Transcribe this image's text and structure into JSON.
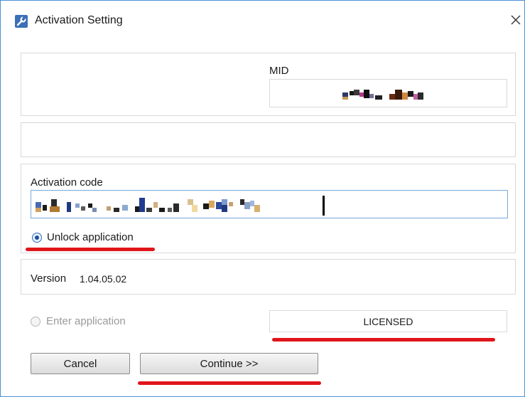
{
  "window": {
    "title": "Activation Setting",
    "close_glyph": "✕",
    "icons": {
      "title": "wrench-icon",
      "close": "close-icon"
    }
  },
  "mid": {
    "label": "MID",
    "value": ""
  },
  "activation": {
    "label": "Activation code",
    "value": ""
  },
  "unlock": {
    "label": "Unlock application",
    "selected": true
  },
  "version": {
    "label": "Version",
    "value": "1.04.05.02"
  },
  "enter": {
    "label": "Enter application",
    "enabled": false
  },
  "license": {
    "status": "LICENSED"
  },
  "buttons": {
    "cancel": "Cancel",
    "continue": "Continue >>"
  },
  "colors": {
    "accent_border": "#4a90d9",
    "highlight_red": "#e0151b"
  }
}
